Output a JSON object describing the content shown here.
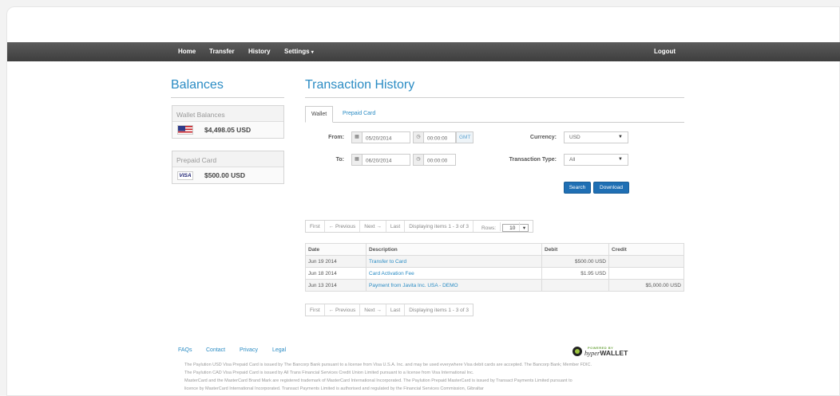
{
  "nav": {
    "home": "Home",
    "transfer": "Transfer",
    "history": "History",
    "settings": "Settings",
    "logout": "Logout"
  },
  "balances": {
    "title": "Balances",
    "wallet_header": "Wallet Balances",
    "wallet_amount": "$4,498.05 USD",
    "prepaid_header": "Prepaid Card",
    "prepaid_card_brand": "VISA",
    "prepaid_amount": "$500.00 USD"
  },
  "history": {
    "title": "Transaction History",
    "tabs": [
      "Wallet",
      "Prepaid Card"
    ],
    "from_label": "From:",
    "from_date": "05/20/2014",
    "from_time": "00:00:00",
    "timezone": "GMT",
    "to_label": "To:",
    "to_date": "06/20/2014",
    "to_time": "00:00:00",
    "currency_label": "Currency:",
    "currency_value": "USD",
    "type_label": "Transaction Type:",
    "type_value": "All",
    "search_button": "Search",
    "download_button": "Download"
  },
  "pager": {
    "first": "First",
    "previous": "← Previous",
    "next": "Next →",
    "last": "Last",
    "info": "Displaying items 1 - 3 of 3",
    "rows_label": "Rows:",
    "rows_value": "10"
  },
  "table": {
    "headers": [
      "Date",
      "Description",
      "Debit",
      "Credit"
    ],
    "rows": [
      {
        "date": "Jun 19 2014",
        "description": "Transfer to Card",
        "debit": "$500.00 USD",
        "credit": ""
      },
      {
        "date": "Jun 18 2014",
        "description": "Card Activation Fee",
        "debit": "$1.95 USD",
        "credit": ""
      },
      {
        "date": "Jun 13 2014",
        "description": "Payment from Javita Inc. USA - DEMO",
        "debit": "",
        "credit": "$5,000.00 USD"
      }
    ]
  },
  "footer": {
    "links": [
      "FAQs",
      "Contact",
      "Privacy",
      "Legal"
    ],
    "powered_by": "POWERED BY",
    "brand_italic": "hyper",
    "brand_bold": "WALLET",
    "lines": [
      "The Paylution USD Visa Prepaid Card is issued by The Bancorp Bank pursuant to a license from Visa U.S.A. Inc. and may be used everywhere Visa debit cards are accepted. The Bancorp Bank; Member FDIC.",
      "The Paylution CAD Visa Prepaid Card is issued by All Trans Financial Services Credit Union Limited pursuant to a license from Visa International Inc.",
      "MasterCard and the MasterCard Brand Mark are registered trademark of MasterCard International Incorporated. The Paylution Prepaid MasterCard is issued by Transact Payments Limited pursuant to",
      "licence by MasterCard International Incorporated. Transact Payments Limited is authorised and regulated by the Financial Services Commission, Gibraltar"
    ]
  }
}
